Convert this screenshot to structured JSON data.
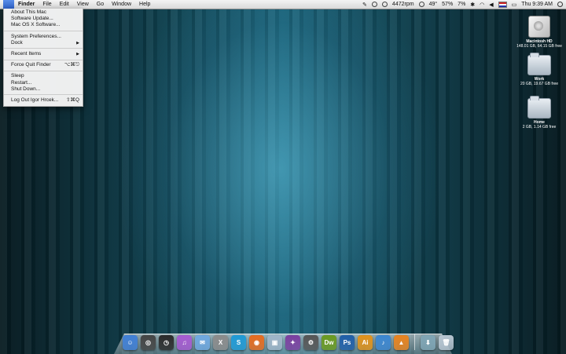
{
  "menubar": {
    "apple_symbol": "",
    "items": [
      "Finder",
      "File",
      "Edit",
      "View",
      "Go",
      "Window",
      "Help"
    ],
    "status": {
      "fan_speed": "4472rpm",
      "temperature": "49°",
      "battery_percent": "57%",
      "cpu": "7%",
      "clock": "Thu 9:39 AM"
    }
  },
  "apple_menu": {
    "groups": [
      [
        {
          "label": "About This Mac"
        },
        {
          "label": "Software Update..."
        },
        {
          "label": "Mac OS X Software..."
        }
      ],
      [
        {
          "label": "System Preferences..."
        },
        {
          "label": "Dock",
          "submenu": true
        }
      ],
      [
        {
          "label": "Recent Items",
          "submenu": true
        }
      ],
      [
        {
          "label": "Force Quit Finder",
          "shortcut": "⌥⌘⎋"
        }
      ],
      [
        {
          "label": "Sleep"
        },
        {
          "label": "Restart..."
        },
        {
          "label": "Shut Down..."
        }
      ],
      [
        {
          "label": "Log Out Igor Hrcek...",
          "shortcut": "⇧⌘Q"
        }
      ]
    ]
  },
  "desktop_icons": [
    {
      "name": "Macintosh HD",
      "info": "148.01 GB, 64.15 GB free",
      "kind": "drive"
    },
    {
      "name": "Work",
      "info": "20 GB, 19.67 GB free",
      "kind": "folder"
    },
    {
      "name": "Home",
      "info": "2 GB, 1.14 GB free",
      "kind": "folder"
    }
  ],
  "dock": {
    "apps": [
      {
        "name": "Finder",
        "icon": "finder-icon",
        "color": "#3f7fd6",
        "glyph": "☺"
      },
      {
        "name": "Dashboard",
        "icon": "dashboard-icon",
        "color": "#444444",
        "glyph": "◎"
      },
      {
        "name": "Time Machine",
        "icon": "clock-icon",
        "color": "#2a2a2a",
        "glyph": "◷"
      },
      {
        "name": "iTunes",
        "icon": "music-icon",
        "color": "#a65ad1",
        "glyph": "♫"
      },
      {
        "name": "Mail",
        "icon": "mail-icon",
        "color": "#6fa8e0",
        "glyph": "✉"
      },
      {
        "name": "X11",
        "icon": "x-icon",
        "color": "#8b8b8b",
        "glyph": "X"
      },
      {
        "name": "Skype",
        "icon": "skype-icon",
        "color": "#1e9ad6",
        "glyph": "S"
      },
      {
        "name": "Firefox",
        "icon": "firefox-icon",
        "color": "#e66b1e",
        "glyph": "◉"
      },
      {
        "name": "App",
        "icon": "cube-icon",
        "color": "#9fb5c8",
        "glyph": "▣"
      },
      {
        "name": "App",
        "icon": "purple-app-icon",
        "color": "#7b3fa0",
        "glyph": "✦"
      },
      {
        "name": "System Preferences",
        "icon": "gear-icon",
        "color": "#555555",
        "glyph": "⚙"
      },
      {
        "name": "Dreamweaver",
        "icon": "dreamweaver-icon",
        "color": "#6a9a1f",
        "glyph": "Dw"
      },
      {
        "name": "Photoshop",
        "icon": "photoshop-icon",
        "color": "#1f5ea8",
        "glyph": "Ps"
      },
      {
        "name": "Illustrator",
        "icon": "illustrator-icon",
        "color": "#e0921a",
        "glyph": "Ai"
      },
      {
        "name": "App",
        "icon": "blue-app-icon",
        "color": "#3b86d1",
        "glyph": "♪"
      },
      {
        "name": "VLC",
        "icon": "vlc-icon",
        "color": "#e8831e",
        "glyph": "▲"
      }
    ],
    "stack_items": [
      {
        "name": "Downloads",
        "icon": "downloads-stack-icon",
        "color": "#7fa5b5",
        "glyph": "⬇"
      },
      {
        "name": "Trash",
        "icon": "trash-icon",
        "color": "#b7c6d2",
        "glyph": "🗑"
      }
    ]
  }
}
